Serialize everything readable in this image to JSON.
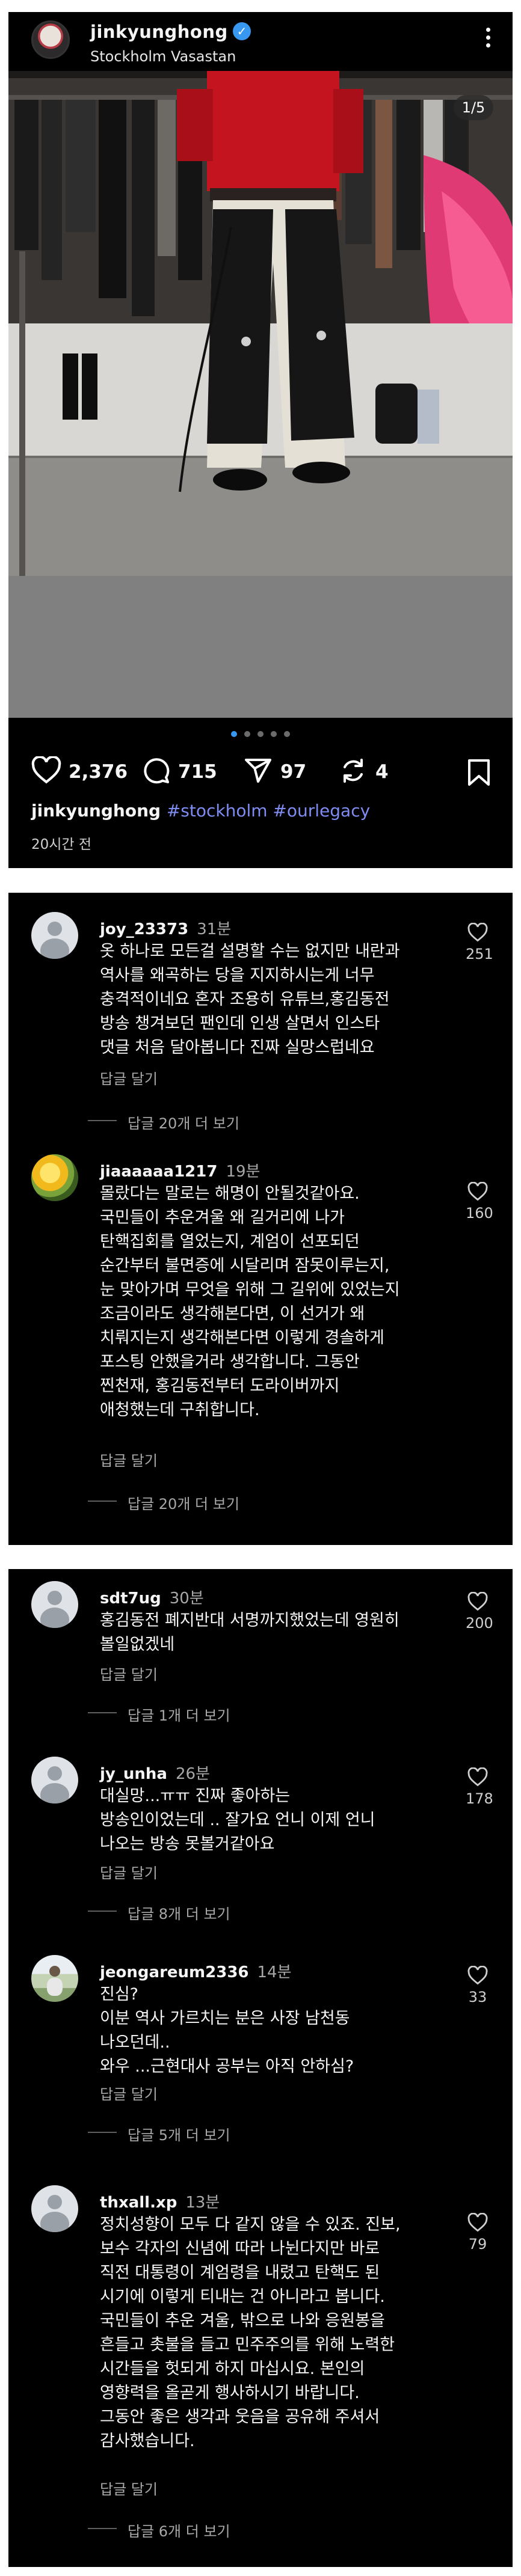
{
  "post": {
    "username": "jinkyunghong",
    "location": "Stockholm Vasastan",
    "image_counter": "1/5",
    "carousel": {
      "total": 5,
      "active": 1
    },
    "likes": "2,376",
    "comments": "715",
    "shares": "97",
    "reposts": "4",
    "caption_user": "jinkyunghong",
    "caption_tags": "#stockholm #ourlegacy",
    "time": "20시간 전",
    "icons": [
      "verified-badge-icon",
      "more-options-icon",
      "heart-icon",
      "comment-icon",
      "share-icon",
      "repost-icon",
      "bookmark-icon"
    ]
  },
  "colors": {
    "accent": "#3897f0",
    "hashtag": "#7f8df3",
    "background": "#000000"
  },
  "ui": {
    "reply": "답글 달기"
  },
  "comments": [
    {
      "user": "joy_23373",
      "time": "31분",
      "text": "옷 하나로 모든걸 설명할 수는 없지만 내란과\n역사를 왜곡하는 당을 지지하시는게 너무\n충격적이네요 혼자 조용히 유튜브,홍김동전\n방송 챙겨보던 팬인데 인생 살면서 인스타\n댓글 처음 달아봅니다 진짜 실망스럽네요",
      "likes": "251",
      "view_replies": "답글 20개 더 보기"
    },
    {
      "user": "jiaaaaaa1217",
      "time": "19분",
      "text": "몰랐다는 말로는 해명이 안될것같아요.\n국민들이 추운겨울 왜 길거리에 나가\n탄핵집회를 열었는지, 계엄이 선포되던\n순간부터 불면증에 시달리며 잠못이루는지,\n눈 맞아가며 무엇을 위해 그 길위에 있었는지\n조금이라도 생각해본다면, 이 선거가 왜\n치뤄지는지 생각해본다면 이렇게 경솔하게\n포스팅 안했을거라 생각합니다. 그동안\n찐천재, 홍김동전부터 도라이버까지\n애청했는데 구취합니다.",
      "likes": "160",
      "view_replies": "답글 20개 더 보기"
    },
    {
      "user": "sdt7ug",
      "time": "30분",
      "text": "홍김동전 폐지반대 서명까지했었는데 영원히\n볼일없겠네",
      "likes": "200",
      "view_replies": "답글 1개 더 보기"
    },
    {
      "user": "jy_unha",
      "time": "26분",
      "text": "대실망...ㅠㅠ 진짜 좋아하는\n방송인이었는데 .. 잘가요 언니 이제 언니\n나오는 방송 못볼거같아요",
      "likes": "178",
      "view_replies": "답글 8개 더 보기"
    },
    {
      "user": "jeongareum2336",
      "time": "14분",
      "text": "진심?\n이분 역사 가르치는 분은 사장 남천동\n나오던데..\n와우 ...근현대사 공부는 아직 안하심?",
      "likes": "33",
      "view_replies": "답글 5개 더 보기"
    },
    {
      "user": "thxall.xp",
      "time": "13분",
      "text": "정치성향이 모두 다 같지 않을 수 있죠. 진보,\n보수 각자의 신념에 따라 나뉜다지만 바로\n직전 대통령이 계엄령을 내렸고 탄핵도 된\n시기에 이렇게 티내는 건 아니라고 봅니다.\n국민들이 추운 겨울, 밖으로 나와 응원봉을\n흔들고 촛불을 들고 민주주의를 위해 노력한\n시간들을 헛되게 하지 마십시요. 본인의\n영향력을 올곧게 행사하시기 바랍니다.\n그동안 좋은 생각과 웃음을 공유해 주셔서\n감사했습니다.",
      "likes": "79",
      "view_replies": "답글 6개 더 보기"
    }
  ]
}
